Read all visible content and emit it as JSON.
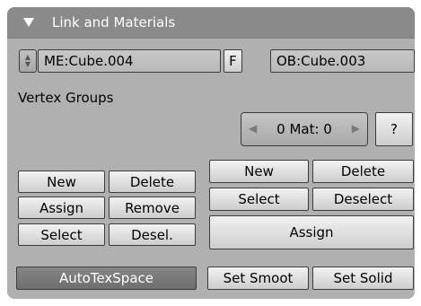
{
  "panel": {
    "title": "Link and Materials"
  },
  "mesh": {
    "name": "ME:Cube.004",
    "fake_user": "F",
    "object_name": "OB:Cube.003"
  },
  "vertex_groups": {
    "label": "Vertex Groups",
    "new": "New",
    "delete": "Delete",
    "assign": "Assign",
    "remove": "Remove",
    "select": "Select",
    "deselect": "Desel."
  },
  "material": {
    "counter": "0 Mat: 0",
    "help": "?",
    "new": "New",
    "delete": "Delete",
    "select": "Select",
    "deselect": "Deselect",
    "assign": "Assign"
  },
  "bottom": {
    "autotexspace": "AutoTexSpace",
    "set_smooth": "Set Smoot",
    "set_solid": "Set Solid"
  }
}
